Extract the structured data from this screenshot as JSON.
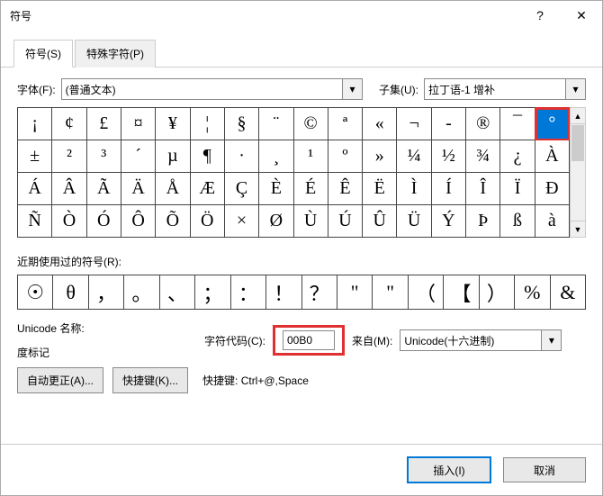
{
  "title": "符号",
  "tabs": {
    "symbols": "符号(S)",
    "special": "特殊字符(P)"
  },
  "fontLabel": "字体(F):",
  "fontValue": "(普通文本)",
  "subsetLabel": "子集(U):",
  "subsetValue": "拉丁语-1 增补",
  "grid": [
    [
      "¡",
      "¢",
      "£",
      "¤",
      "¥",
      "¦",
      "§",
      "¨",
      "©",
      "ª",
      "«",
      "¬",
      "-",
      "®",
      "¯",
      "°"
    ],
    [
      "±",
      "²",
      "³",
      "´",
      "µ",
      "¶",
      "·",
      "¸",
      "¹",
      "º",
      "»",
      "¼",
      "½",
      "¾",
      "¿",
      "À"
    ],
    [
      "Á",
      "Â",
      "Ã",
      "Ä",
      "Å",
      "Æ",
      "Ç",
      "È",
      "É",
      "Ê",
      "Ë",
      "Ì",
      "Í",
      "Î",
      "Ï",
      "Ð"
    ],
    [
      "Ñ",
      "Ò",
      "Ó",
      "Ô",
      "Õ",
      "Ö",
      "×",
      "Ø",
      "Ù",
      "Ú",
      "Û",
      "Ü",
      "Ý",
      "Þ",
      "ß",
      "à"
    ]
  ],
  "selected": {
    "row": 0,
    "col": 15
  },
  "recentLabel": "近期使用过的符号(R):",
  "recent": [
    "☉",
    "θ",
    "，",
    "。",
    "、",
    "；",
    "：",
    "！",
    "？",
    "\"",
    "\"",
    "（",
    "【",
    "）",
    "%",
    "&"
  ],
  "unicodeNameLabel": "Unicode 名称:",
  "unicodeName": "度标记",
  "codeLabel": "字符代码(C):",
  "codeValue": "00B0",
  "fromLabel": "来自(M):",
  "fromValue": "Unicode(十六进制)",
  "autoCorrectBtn": "自动更正(A)...",
  "shortcutBtn": "快捷键(K)...",
  "shortcutLabel": "快捷键:",
  "shortcutValue": "Ctrl+@,Space",
  "insertBtn": "插入(I)",
  "cancelBtn": "取消"
}
